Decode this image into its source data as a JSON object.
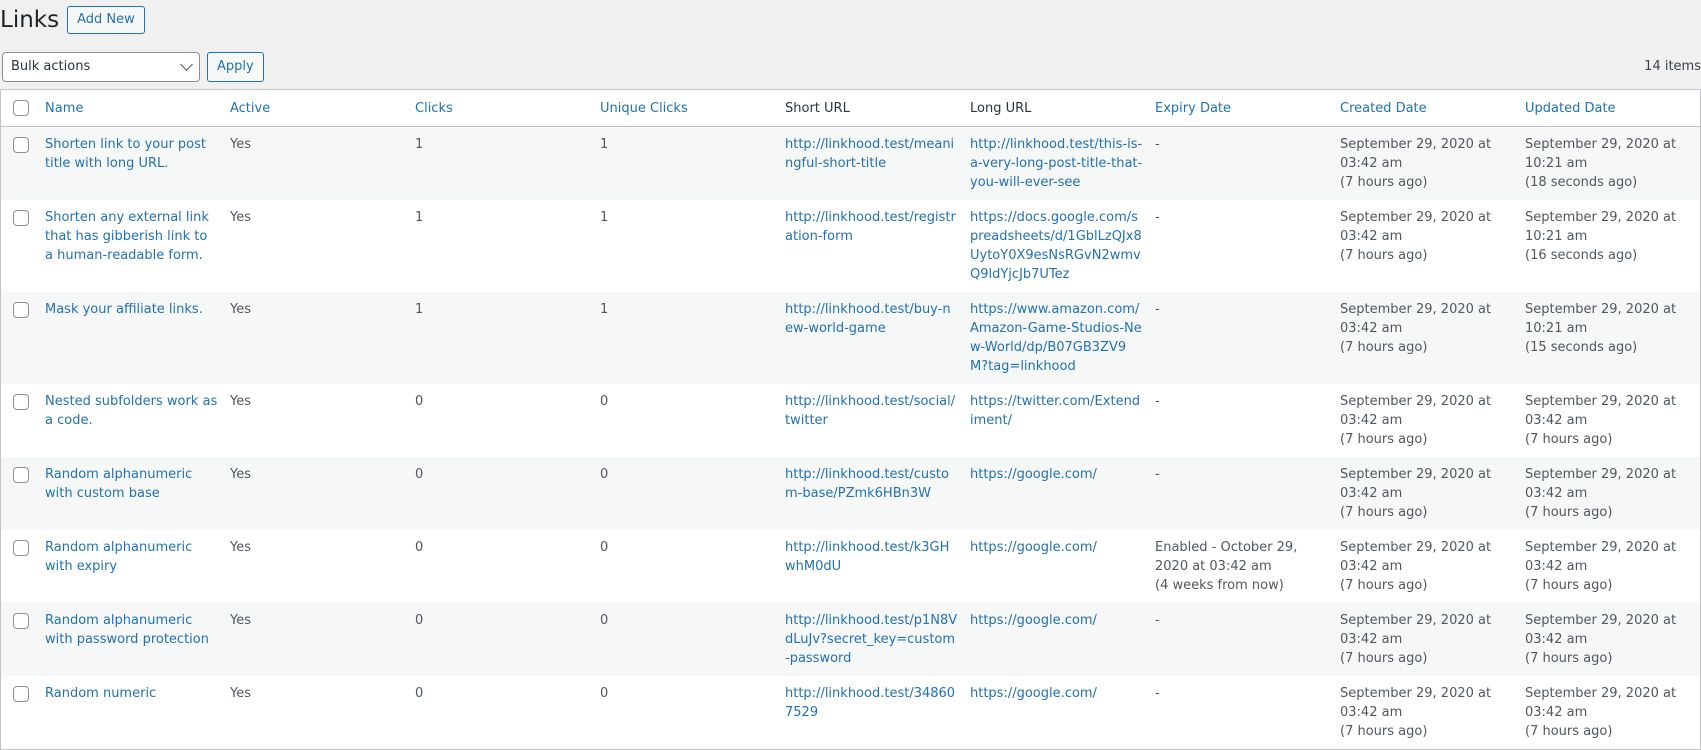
{
  "header": {
    "title": "Links",
    "add_new": "Add New"
  },
  "toolbar": {
    "bulk_actions": "Bulk actions",
    "apply": "Apply",
    "items_count": "14 items"
  },
  "columns": {
    "name": "Name",
    "active": "Active",
    "clicks": "Clicks",
    "unique_clicks": "Unique Clicks",
    "short_url": "Short URL",
    "long_url": "Long URL",
    "expiry_date": "Expiry Date",
    "created_date": "Created Date",
    "updated_date": "Updated Date"
  },
  "rows": [
    {
      "name": "Shorten link to your post title with long URL.",
      "active": "Yes",
      "clicks": "1",
      "unique_clicks": "1",
      "short_url": "http://linkhood.test/meaningful-short-title",
      "long_url": "http://linkhood.test/this-is-a-very-long-post-title-that-you-will-ever-see",
      "expiry": "-",
      "expiry_rel": "",
      "created": "September 29, 2020 at 03:42 am",
      "created_rel": "(7 hours ago)",
      "updated": "September 29, 2020 at 10:21 am",
      "updated_rel": "(18 seconds ago)"
    },
    {
      "name": "Shorten any external link that has gibberish link to a human-readable form.",
      "active": "Yes",
      "clicks": "1",
      "unique_clicks": "1",
      "short_url": "http://linkhood.test/registration-form",
      "long_url": "https://docs.google.com/spreadsheets/d/1GblLzQJx8UytoY0X9esNsRGvN2wmvQ9ldYjcJb7UTez",
      "expiry": "-",
      "expiry_rel": "",
      "created": "September 29, 2020 at 03:42 am",
      "created_rel": "(7 hours ago)",
      "updated": "September 29, 2020 at 10:21 am",
      "updated_rel": "(16 seconds ago)"
    },
    {
      "name": "Mask your affiliate links.",
      "active": "Yes",
      "clicks": "1",
      "unique_clicks": "1",
      "short_url": "http://linkhood.test/buy-new-world-game",
      "long_url": "https://www.amazon.com/Amazon-Game-Studios-New-World/dp/B07GB3ZV9M?tag=linkhood",
      "expiry": "-",
      "expiry_rel": "",
      "created": "September 29, 2020 at 03:42 am",
      "created_rel": "(7 hours ago)",
      "updated": "September 29, 2020 at 10:21 am",
      "updated_rel": "(15 seconds ago)"
    },
    {
      "name": "Nested subfolders work as a code.",
      "active": "Yes",
      "clicks": "0",
      "unique_clicks": "0",
      "short_url": "http://linkhood.test/social/twitter",
      "long_url": "https://twitter.com/Extendiment/",
      "expiry": "-",
      "expiry_rel": "",
      "created": "September 29, 2020 at 03:42 am",
      "created_rel": "(7 hours ago)",
      "updated": "September 29, 2020 at 03:42 am",
      "updated_rel": "(7 hours ago)"
    },
    {
      "name": "Random alphanumeric with custom base",
      "active": "Yes",
      "clicks": "0",
      "unique_clicks": "0",
      "short_url": "http://linkhood.test/custom-base/PZmk6HBn3W",
      "long_url": "https://google.com/",
      "expiry": "-",
      "expiry_rel": "",
      "created": "September 29, 2020 at 03:42 am",
      "created_rel": "(7 hours ago)",
      "updated": "September 29, 2020 at 03:42 am",
      "updated_rel": "(7 hours ago)"
    },
    {
      "name": "Random alphanumeric with expiry",
      "active": "Yes",
      "clicks": "0",
      "unique_clicks": "0",
      "short_url": "http://linkhood.test/k3GHwhM0dU",
      "long_url": "https://google.com/",
      "expiry": "Enabled - October 29, 2020 at 03:42 am",
      "expiry_rel": "(4 weeks from now)",
      "created": "September 29, 2020 at 03:42 am",
      "created_rel": "(7 hours ago)",
      "updated": "September 29, 2020 at 03:42 am",
      "updated_rel": "(7 hours ago)"
    },
    {
      "name": "Random alphanumeric with password protection",
      "active": "Yes",
      "clicks": "0",
      "unique_clicks": "0",
      "short_url": "http://linkhood.test/p1N8VdLuJv?secret_key=custom-password",
      "long_url": "https://google.com/",
      "expiry": "-",
      "expiry_rel": "",
      "created": "September 29, 2020 at 03:42 am",
      "created_rel": "(7 hours ago)",
      "updated": "September 29, 2020 at 03:42 am",
      "updated_rel": "(7 hours ago)"
    },
    {
      "name": "Random numeric",
      "active": "Yes",
      "clicks": "0",
      "unique_clicks": "0",
      "short_url": "http://linkhood.test/348607529",
      "long_url": "https://google.com/",
      "expiry": "-",
      "expiry_rel": "",
      "created": "September 29, 2020 at 03:42 am",
      "created_rel": "(7 hours ago)",
      "updated": "September 29, 2020 at 03:42 am",
      "updated_rel": "(7 hours ago)"
    }
  ]
}
